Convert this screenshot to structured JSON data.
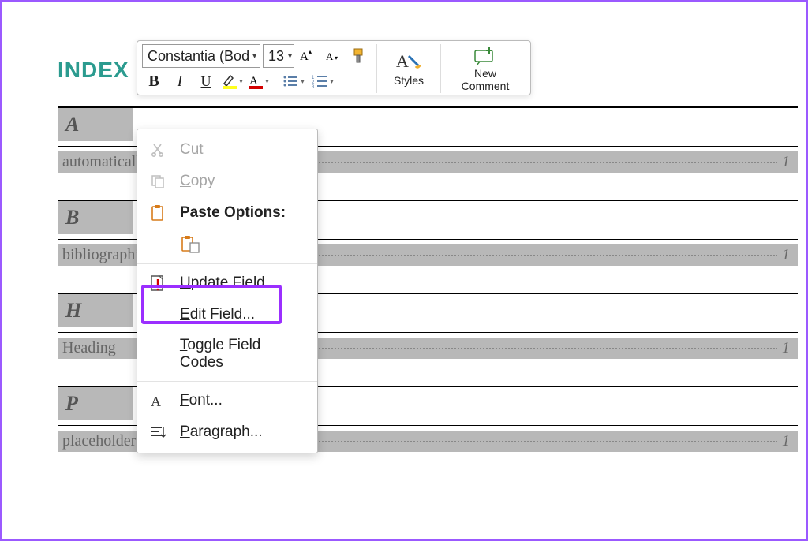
{
  "doc": {
    "index_title": "INDEX",
    "sections": [
      {
        "letter": "A",
        "entry": "automatically",
        "page": "1"
      },
      {
        "letter": "B",
        "entry": "bibliographies",
        "page": "1"
      },
      {
        "letter": "H",
        "entry": "Heading",
        "page": "1"
      },
      {
        "letter": "P",
        "entry": "placeholder",
        "page": "1"
      }
    ]
  },
  "toolbar": {
    "font_name": "Constantia (Bod",
    "font_size": "13",
    "bold": "B",
    "italic": "I",
    "styles_label": "Styles",
    "new_comment_line1": "New",
    "new_comment_line2": "Comment"
  },
  "ctx": {
    "cut": "Cut",
    "copy": "Copy",
    "paste_options": "Paste Options:",
    "update_field": "Update Field",
    "edit_field": "Edit Field...",
    "toggle_field_codes": "Toggle Field Codes",
    "font": "Font...",
    "paragraph": "Paragraph..."
  }
}
